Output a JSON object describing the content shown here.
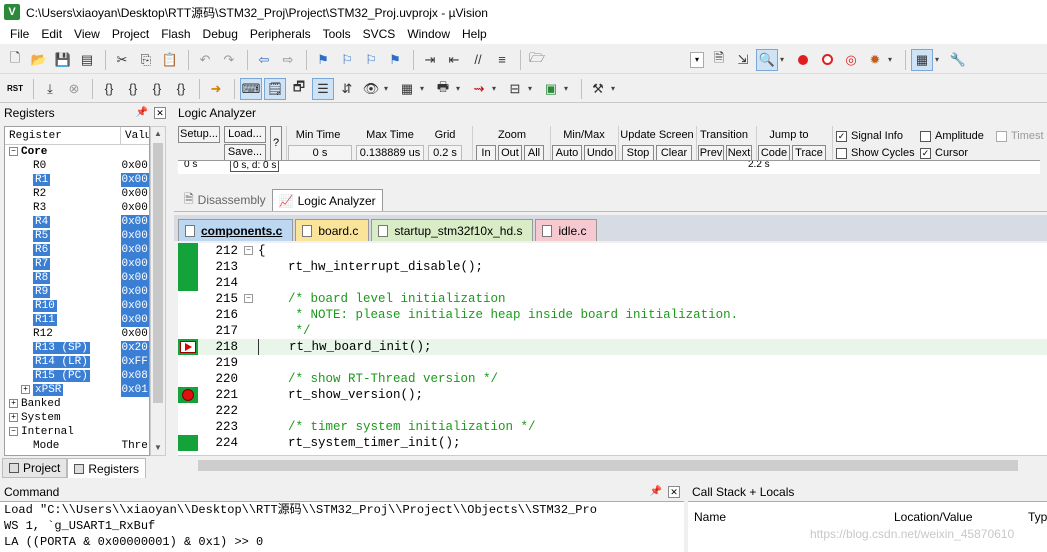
{
  "window": {
    "title": "C:\\Users\\xiaoyan\\Desktop\\RTT源码\\STM32_Proj\\Project\\STM32_Proj.uvprojx - µVision"
  },
  "menu": [
    "File",
    "Edit",
    "View",
    "Project",
    "Flash",
    "Debug",
    "Peripherals",
    "Tools",
    "SVCS",
    "Window",
    "Help"
  ],
  "toolbar2": {
    "reset_label": "RST"
  },
  "registers": {
    "title": "Registers",
    "col_register": "Register",
    "col_value": "Valu",
    "rows": [
      {
        "name": "Core",
        "value": "",
        "level": 0,
        "exp": "−",
        "sel": false,
        "bold": true
      },
      {
        "name": "R0",
        "value": "0x00",
        "level": 2,
        "exp": "",
        "sel": false
      },
      {
        "name": "R1",
        "value": "0x00",
        "level": 2,
        "exp": "",
        "sel": true
      },
      {
        "name": "R2",
        "value": "0x00",
        "level": 2,
        "exp": "",
        "sel": false
      },
      {
        "name": "R3",
        "value": "0x00",
        "level": 2,
        "exp": "",
        "sel": false
      },
      {
        "name": "R4",
        "value": "0x00",
        "level": 2,
        "exp": "",
        "sel": true
      },
      {
        "name": "R5",
        "value": "0x00",
        "level": 2,
        "exp": "",
        "sel": true
      },
      {
        "name": "R6",
        "value": "0x00",
        "level": 2,
        "exp": "",
        "sel": true
      },
      {
        "name": "R7",
        "value": "0x00",
        "level": 2,
        "exp": "",
        "sel": true
      },
      {
        "name": "R8",
        "value": "0x00",
        "level": 2,
        "exp": "",
        "sel": true
      },
      {
        "name": "R9",
        "value": "0x00",
        "level": 2,
        "exp": "",
        "sel": true
      },
      {
        "name": "R10",
        "value": "0x00",
        "level": 2,
        "exp": "",
        "sel": true
      },
      {
        "name": "R11",
        "value": "0x00",
        "level": 2,
        "exp": "",
        "sel": true
      },
      {
        "name": "R12",
        "value": "0x00",
        "level": 2,
        "exp": "",
        "sel": false
      },
      {
        "name": "R13 (SP)",
        "value": "0x20",
        "level": 2,
        "exp": "",
        "sel": true
      },
      {
        "name": "R14 (LR)",
        "value": "0xFF",
        "level": 2,
        "exp": "",
        "sel": true
      },
      {
        "name": "R15 (PC)",
        "value": "0x08",
        "level": 2,
        "exp": "",
        "sel": true
      },
      {
        "name": "xPSR",
        "value": "0x01",
        "level": 1,
        "exp": "+",
        "sel": true
      },
      {
        "name": "Banked",
        "value": "",
        "level": 0,
        "exp": "+",
        "sel": false
      },
      {
        "name": "System",
        "value": "",
        "level": 0,
        "exp": "+",
        "sel": false
      },
      {
        "name": "Internal",
        "value": "",
        "level": 0,
        "exp": "−",
        "sel": false
      },
      {
        "name": "Mode",
        "value": "Thre",
        "level": 2,
        "exp": "",
        "sel": false
      }
    ],
    "tab_project": "Project",
    "tab_registers": "Registers"
  },
  "logic_analyzer": {
    "title": "Logic Analyzer",
    "setup": "Setup...",
    "load": "Load...",
    "save": "Save...",
    "help": "?",
    "min_time_label": "Min Time",
    "min_time_value": "0 s",
    "max_time_label": "Max Time",
    "max_time_value": "0.138889 us",
    "grid_label": "Grid",
    "grid_value": "0.2 s",
    "zoom_label": "Zoom",
    "zoom_in": "In",
    "zoom_out": "Out",
    "zoom_all": "All",
    "minmax_label": "Min/Max",
    "auto": "Auto",
    "undo": "Undo",
    "update_label": "Update Screen",
    "stop": "Stop",
    "clear": "Clear",
    "transition_label": "Transition",
    "prev": "Prev",
    "next": "Next",
    "jump_label": "Jump to",
    "code": "Code",
    "trace": "Trace",
    "signal_info": "Signal Info",
    "show_cycles": "Show Cycles",
    "amplitude": "Amplitude",
    "cursor": "Cursor",
    "timestamps": "Timest",
    "strip_left": "0 s",
    "strip_mid": "0 s,  d: 0 s",
    "strip_right": "2.2 s"
  },
  "view_tabs": {
    "disassembly": "Disassembly",
    "logic_analyzer": "Logic Analyzer"
  },
  "file_tabs": [
    "components.c",
    "board.c",
    "startup_stm32f10x_hd.s",
    "idle.c"
  ],
  "editor": {
    "lines": [
      {
        "num": "212",
        "code": "{",
        "type": "code",
        "green": true,
        "fold": "−",
        "mark": "",
        "cur": false
      },
      {
        "num": "213",
        "code": "    rt_hw_interrupt_disable();",
        "type": "code",
        "green": true,
        "fold": "",
        "mark": "",
        "cur": false
      },
      {
        "num": "214",
        "code": "",
        "type": "code",
        "green": true,
        "fold": "",
        "mark": "",
        "cur": false
      },
      {
        "num": "215",
        "code": "    /* board level initialization",
        "type": "cmt",
        "green": false,
        "fold": "−",
        "mark": "",
        "cur": false
      },
      {
        "num": "216",
        "code": "     * NOTE: please initialize heap inside board initialization.",
        "type": "cmt",
        "green": false,
        "fold": "",
        "mark": "",
        "cur": false
      },
      {
        "num": "217",
        "code": "     */",
        "type": "cmt",
        "green": false,
        "fold": "",
        "mark": "",
        "cur": false
      },
      {
        "num": "218",
        "code": "    rt_hw_board_init();",
        "type": "code",
        "green": true,
        "fold": "",
        "mark": "arrow",
        "cur": true
      },
      {
        "num": "219",
        "code": "",
        "type": "code",
        "green": false,
        "fold": "",
        "mark": "",
        "cur": false
      },
      {
        "num": "220",
        "code": "    /* show RT-Thread version */",
        "type": "cmt",
        "green": false,
        "fold": "",
        "mark": "",
        "cur": false
      },
      {
        "num": "221",
        "code": "    rt_show_version();",
        "type": "code",
        "green": true,
        "fold": "",
        "mark": "bp",
        "cur": false
      },
      {
        "num": "222",
        "code": "",
        "type": "code",
        "green": false,
        "fold": "",
        "mark": "",
        "cur": false
      },
      {
        "num": "223",
        "code": "    /* timer system initialization */",
        "type": "cmt",
        "green": false,
        "fold": "",
        "mark": "",
        "cur": false
      },
      {
        "num": "224",
        "code": "    rt_system_timer_init();",
        "type": "code",
        "green": true,
        "fold": "",
        "mark": "",
        "cur": false
      }
    ]
  },
  "command": {
    "title": "Command",
    "lines": [
      "Load \"C:\\\\Users\\\\xiaoyan\\\\Desktop\\\\RTT源码\\\\STM32_Proj\\\\Project\\\\Objects\\\\STM32_Pro",
      "WS 1, `g_USART1_RxBuf",
      "LA ((PORTA & 0x00000001) & 0x1) >> 0"
    ]
  },
  "callstack": {
    "title": "Call Stack + Locals",
    "col_name": "Name",
    "col_location": "Location/Value",
    "col_type": "Typ"
  },
  "watermark": "https://blog.csdn.net/weixin_45870610"
}
